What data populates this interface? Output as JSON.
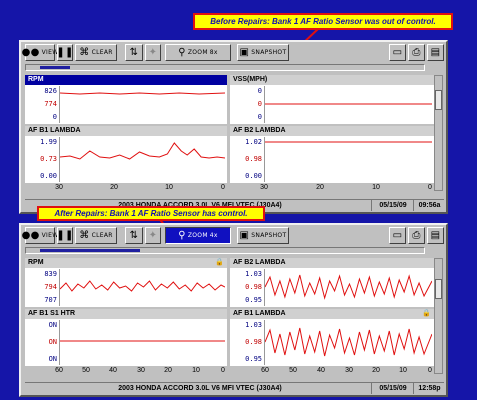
{
  "callouts": {
    "before": "Before Repairs: Bank 1 AF Ratio Sensor was out of control.",
    "after": "After Repairs: Bank 1 AF Ratio Sensor has control."
  },
  "toolbar": {
    "view": "VIEW",
    "clear": "CLEAR",
    "zoom": "ZOOM",
    "zoom_level_1": "8x",
    "zoom_level_2": "4x",
    "snapshot": "SNAPSHOT"
  },
  "screen1": {
    "panels": {
      "tl": {
        "title": "RPM",
        "y": [
          "826",
          "774",
          "0"
        ]
      },
      "tr": {
        "title": "VSS(MPH)",
        "y": [
          "0",
          "0",
          "0"
        ]
      },
      "bl": {
        "title": "AF B1 LAMBDA",
        "y": [
          "1.99",
          "0.73",
          "0.00"
        ]
      },
      "br": {
        "title": "AF B2 LAMBDA",
        "y": [
          "1.02",
          "0.98",
          "0.00"
        ]
      }
    },
    "xticks": [
      "30",
      "20",
      "10",
      "0",
      "30",
      "20",
      "10",
      "0"
    ],
    "status": {
      "vehicle": "2003 HONDA ACCORD 3.0L V6 MFI VTEC (J30A4)",
      "date": "05/15/09",
      "time": "09:56a"
    }
  },
  "screen2": {
    "panels": {
      "tl": {
        "title": "RPM",
        "y": [
          "839",
          "794",
          "707"
        ]
      },
      "tr": {
        "title": "AF B2 LAMBDA",
        "y": [
          "1.03",
          "0.98",
          "0.95"
        ]
      },
      "bl": {
        "title": "AF B1 S1 HTR",
        "y": [
          "ON",
          "ON",
          "ON"
        ]
      },
      "br": {
        "title": "AF B1 LAMBDA",
        "y": [
          "1.03",
          "0.98",
          "0.95"
        ]
      }
    },
    "xticks": [
      "60",
      "50",
      "40",
      "30",
      "20",
      "10",
      "0",
      "60",
      "50",
      "40",
      "30",
      "20",
      "10",
      "0"
    ],
    "status": {
      "vehicle": "2003 HONDA ACCORD 3.0L V6 MFI VTEC (J30A4)",
      "date": "05/15/09",
      "time": "12:58p"
    }
  },
  "colors": {
    "background": "#1515a8",
    "callout_fill": "#ffff00",
    "callout_border": "#e01010",
    "trace": "#e01010",
    "selected_title": "#0000a0"
  },
  "icons": [
    "binoculars-icon",
    "pause-icon",
    "clear-icon",
    "sort-icon",
    "wand-icon",
    "zoom-icon",
    "camera-icon",
    "folder-icon",
    "printer-icon",
    "toolbox-icon",
    "lock-icon"
  ]
}
